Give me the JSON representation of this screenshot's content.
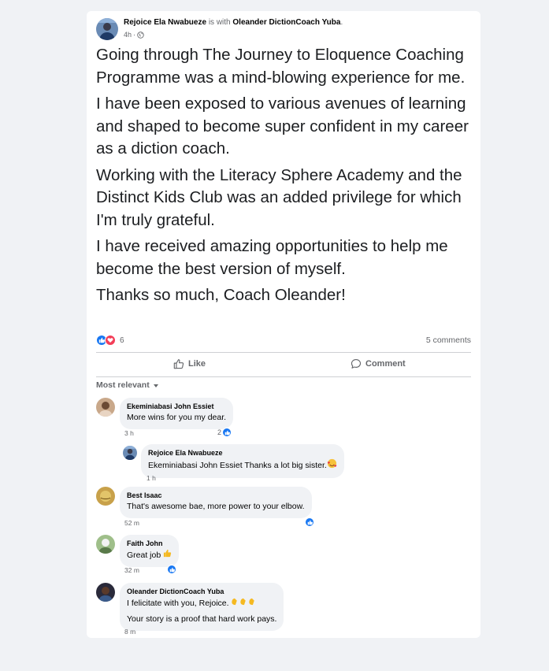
{
  "post": {
    "author": "Rejoice Ela Nwabueze",
    "with_text": " is with ",
    "tagged": "Oleander DictionCoach Yuba",
    "tagged_suffix": ".",
    "time": "4h",
    "separator": "·",
    "paragraphs": [
      "Going through The Journey to Eloquence Coaching Programme was a mind-blowing experience for me.",
      "I have been exposed to various avenues of learning and shaped to become  super confident in my career as a diction coach.",
      "Working with the Literacy Sphere Academy and the Distinct Kids Club was an added privilege for which I'm truly grateful.",
      "I have received amazing opportunities to help me become the best version of myself.",
      "Thanks so much, Coach Oleander!"
    ],
    "reaction_count": "6",
    "comments_count": "5 comments",
    "reaction_icons": [
      "like-icon",
      "love-icon"
    ]
  },
  "actions": {
    "like": "Like",
    "comment": "Comment"
  },
  "sort": {
    "label": "Most relevant"
  },
  "comments": [
    {
      "name": "Ekeminiabasi John Essiet",
      "text": "More wins for you my dear.",
      "time": "3 h",
      "likes": "2"
    },
    {
      "name": "Rejoice Ela Nwabueze",
      "text": "Ekeminiabasi John Essiet Thanks a lot big sister.",
      "time": "1 h",
      "emoji": "smiling-face-with-hearts-icon"
    },
    {
      "name": "Best Isaac",
      "text": "That's awesome bae, more power to your elbow.",
      "time": "52 m"
    },
    {
      "name": "Faith John",
      "text": "Great job ",
      "time": "32 m",
      "emoji": "thumbs-up-icon"
    },
    {
      "name": "Oleander DictionCoach Yuba",
      "text": "I felicitate with you, Rejoice.",
      "text2": "Your story is a proof that hard work pays.",
      "time": "8 m",
      "emoji": "clapping-hands-icon"
    }
  ],
  "colors": {
    "background": "#f0f2f5",
    "card": "#ffffff",
    "brand_blue": "#1877f2",
    "love_red": "#f33e58",
    "secondary_text": "#65676b"
  }
}
